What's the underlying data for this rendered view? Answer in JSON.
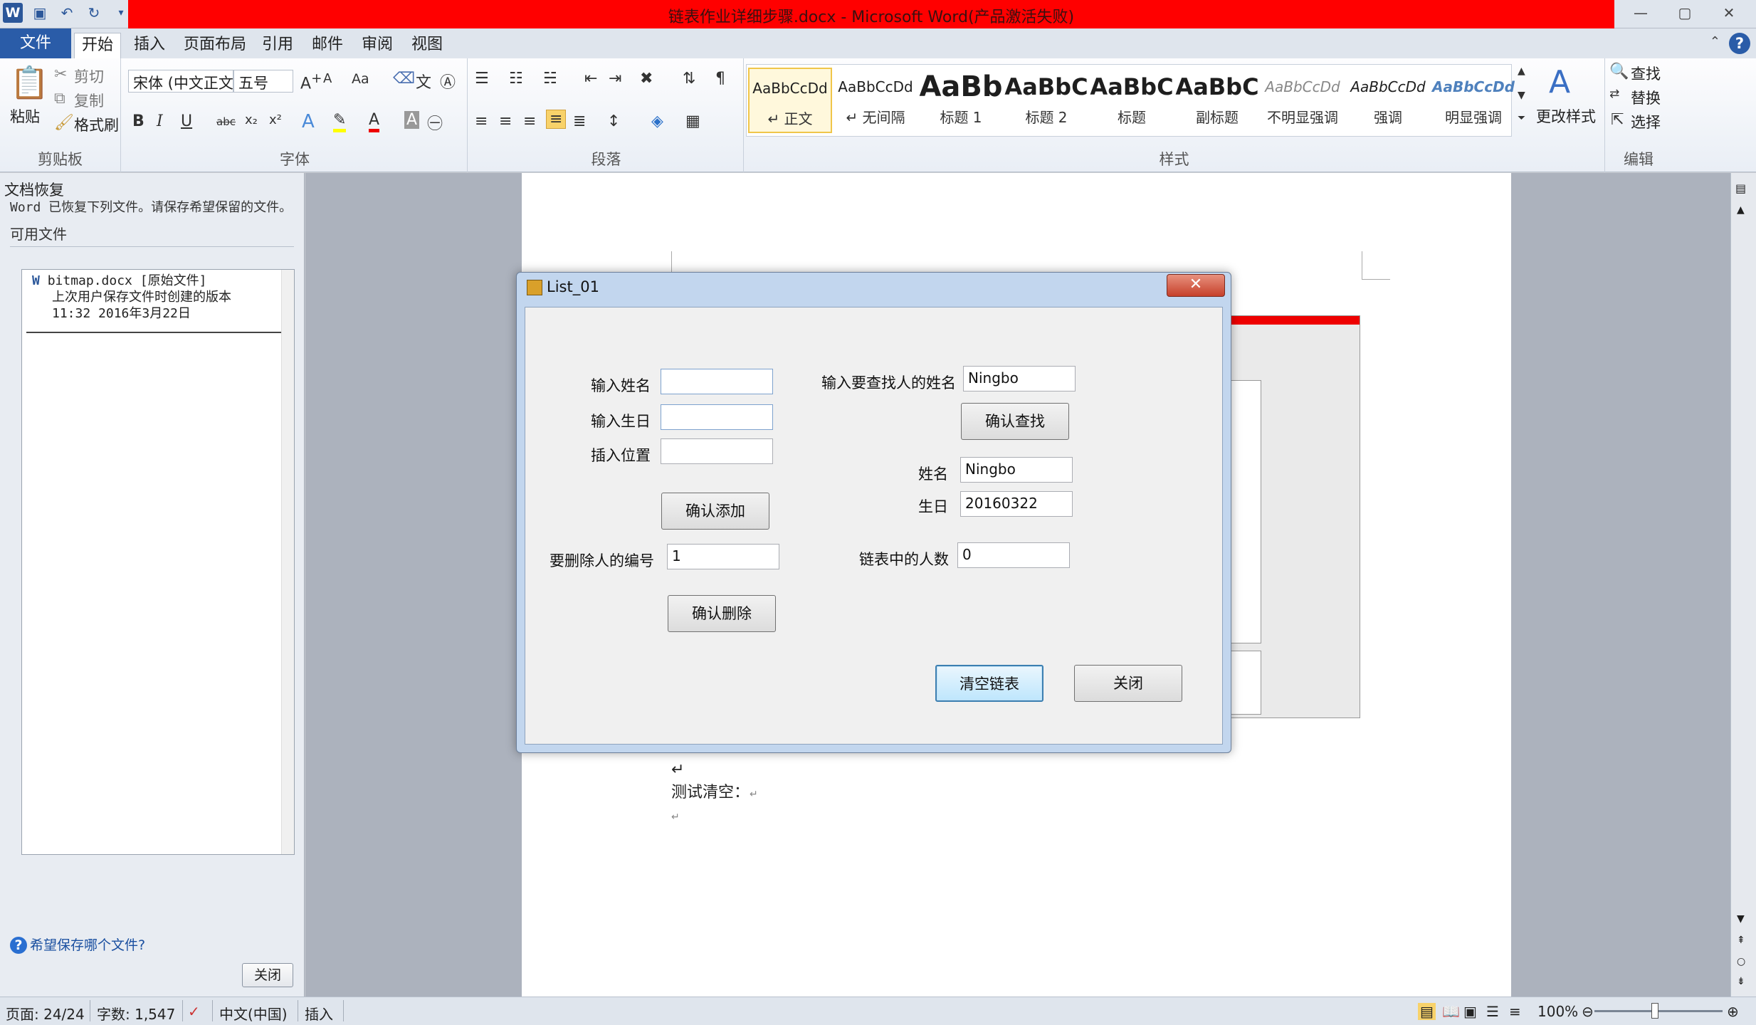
{
  "window": {
    "title": "链表作业详细步骤.docx - Microsoft Word(产品激活失败)",
    "min": "—",
    "max": "▢",
    "close": "✕"
  },
  "qat": {
    "word": "W",
    "save": "💾",
    "undo": "↶",
    "redo": "↻",
    "more": "▾"
  },
  "tabs": [
    "文件",
    "开始",
    "插入",
    "页面布局",
    "引用",
    "邮件",
    "审阅",
    "视图"
  ],
  "ribbon": {
    "clipboard": {
      "paste": "粘贴",
      "cut": "剪切",
      "copy": "复制",
      "format_painter": "格式刷",
      "label": "剪贴板"
    },
    "font": {
      "font_name": "宋体 (中文正文)",
      "font_size": "五号",
      "label": "字体",
      "bold": "B",
      "italic": "I",
      "underline": "U",
      "strike": "abc",
      "sub": "x₂",
      "sup": "x²"
    },
    "paragraph": {
      "label": "段落"
    },
    "styles": {
      "label": "样式",
      "items": [
        {
          "sample": "AaBbCcDd",
          "name": "↵ 正文"
        },
        {
          "sample": "AaBbCcDd",
          "name": "↵ 无间隔"
        },
        {
          "sample": "AaBb",
          "name": "标题 1"
        },
        {
          "sample": "AaBbC",
          "name": "标题 2"
        },
        {
          "sample": "AaBbC",
          "name": "标题"
        },
        {
          "sample": "AaBbC",
          "name": "副标题"
        },
        {
          "sample": "AaBbCcDd",
          "name": "不明显强调"
        },
        {
          "sample": "AaBbCcDd",
          "name": "强调"
        },
        {
          "sample": "AaBbCcDd",
          "name": "明显强调"
        }
      ],
      "change_styles": "更改样式"
    },
    "editing": {
      "find": "查找",
      "replace": "替换",
      "select": "选择",
      "label": "编辑"
    }
  },
  "recovery": {
    "title": "文档恢复",
    "desc": "Word 已恢复下列文件。请保存希望保留的文件。",
    "available": "可用文件",
    "file": {
      "name": "bitmap.docx  [原始文件]",
      "line2": "上次用户保存文件时创建的版本",
      "line3": "11:32 2016年3月22日"
    },
    "help": "希望保存哪个文件?",
    "close": "关闭"
  },
  "document": {
    "line1": "测试清空：",
    "ret": "↵"
  },
  "dialog": {
    "title": "List_01",
    "close": "✕",
    "name_label": "输入姓名",
    "birthday_label": "输入生日",
    "position_label": "插入位置",
    "name_value": "",
    "birthday_value": "",
    "position_value": "",
    "add_button": "确认添加",
    "delete_label": "要删除人的编号",
    "delete_value": "1",
    "delete_button": "确认删除",
    "search_label": "输入要查找人的姓名",
    "search_value": "Ningbo",
    "search_button": "确认查找",
    "result_name_label": "姓名",
    "result_name_value": "Ningbo",
    "result_birthday_label": "生日",
    "result_birthday_value": "20160322",
    "count_label": "链表中的人数",
    "count_value": "0",
    "clear_button": "清空链表",
    "close_button": "关闭"
  },
  "status": {
    "page": "页面: 24/24",
    "words": "字数: 1,547",
    "lang": "中文(中国)",
    "mode": "插入",
    "zoom": "100%"
  }
}
